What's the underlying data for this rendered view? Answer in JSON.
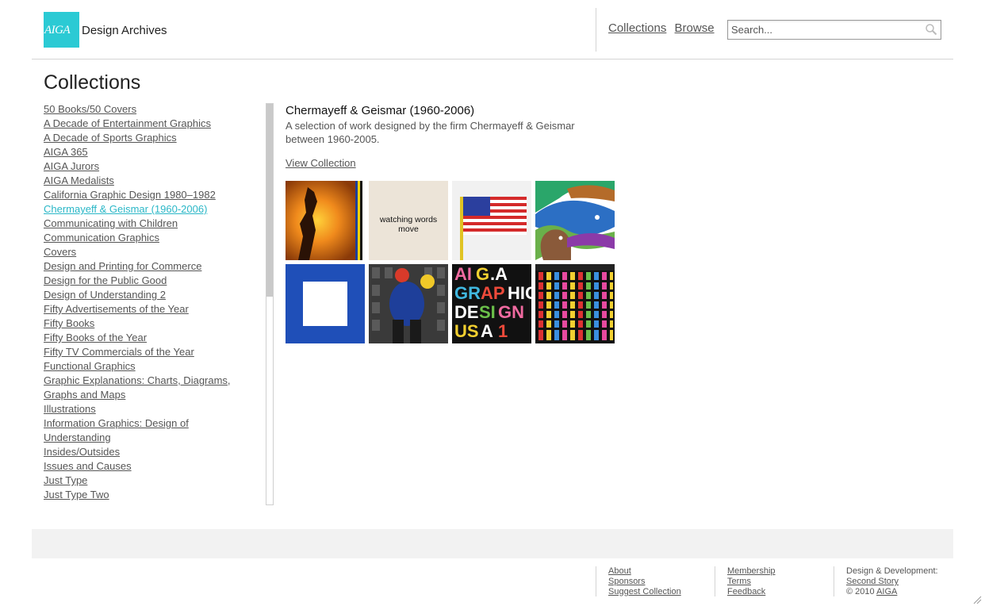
{
  "header": {
    "logo_text": "AIGA",
    "site_title": "Design Archives",
    "nav": [
      "Collections",
      "Browse"
    ],
    "search_placeholder": "Search..."
  },
  "page_title": "Collections",
  "collections": [
    "50 Books/50 Covers",
    "A Decade of Entertainment Graphics",
    "A Decade of Sports Graphics",
    "AIGA 365",
    "AIGA Jurors",
    "AIGA Medalists",
    "California Graphic Design 1980–1982",
    "Chermayeff & Geismar (1960-2006)",
    "Communicating with Children",
    "Communication Graphics",
    "Covers",
    "Design and Printing for Commerce",
    "Design for the Public Good",
    "Design of Understanding 2",
    "Fifty Advertisements of the Year",
    "Fifty Books",
    "Fifty Books of the Year",
    "Fifty TV Commercials of the Year",
    "Functional Graphics",
    "Graphic Explanations: Charts, Diagrams,",
    "Graphs and Maps",
    "Illustrations",
    "Information Graphics: Design of",
    "Understanding",
    "Insides/Outsides",
    "Issues and Causes",
    "Just Type",
    "Just Type Two"
  ],
  "selected_index": 7,
  "detail": {
    "title": "Chermayeff & Geismar (1960-2006)",
    "description": "A selection of work designed by the firm Chermayeff & Geismar between 1960-2005.",
    "view_link": "View Collection"
  },
  "thumbnails": [
    {
      "name": "orange-figure-poster",
      "text": ""
    },
    {
      "name": "watching-words-move",
      "text": "watching words move"
    },
    {
      "name": "american-flag",
      "text": ""
    },
    {
      "name": "fish-bird-poster",
      "text": ""
    },
    {
      "name": "chase-logo",
      "text": ""
    },
    {
      "name": "sculpture-photo",
      "text": ""
    },
    {
      "name": "aiga-graphic-design-usa",
      "text": "AIGA GRAPHIC DESIGN USA"
    },
    {
      "name": "dots-poster",
      "text": ""
    }
  ],
  "footer": {
    "col1": [
      "About",
      "Sponsors",
      "Suggest Collection"
    ],
    "col2": [
      "Membership",
      "Terms",
      "Feedback"
    ],
    "col3_label": "Design & Development:",
    "col3_link": "Second Story",
    "col3_copy": "© 2010",
    "col3_copy_link": "AIGA"
  },
  "colors": {
    "accent": "#2bcad4",
    "active_link": "#2ab7c7"
  }
}
